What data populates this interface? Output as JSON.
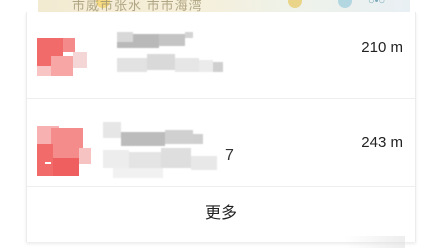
{
  "map": {
    "peek_text": "市威市张水 市市海湾",
    "peek_text_2": "○•○"
  },
  "results": [
    {
      "distance": "210 m"
    },
    {
      "distance": "243 m",
      "visible_fragment": "7"
    }
  ],
  "more_label": "更多",
  "colors": {
    "thumb_red": "#f26b6b",
    "thumb_pink": "#f7a5a5",
    "placeholder_gray": "#dcdcdc"
  }
}
